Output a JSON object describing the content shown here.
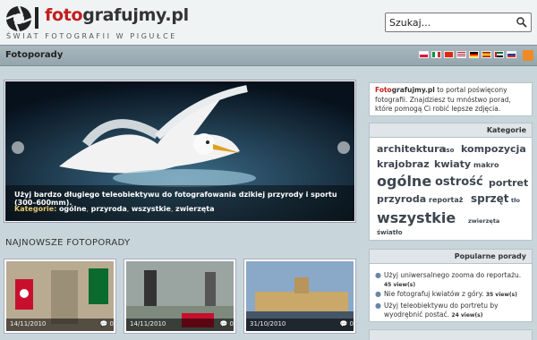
{
  "header": {
    "logo_red": "foto",
    "logo_dark": "grafujmy.pl",
    "tagline": "ŚWIAT FOTOGRAFII W PIGUŁCE",
    "search_placeholder": "Szukaj..."
  },
  "nav": {
    "title": "Fotoporady"
  },
  "flags": [
    "pl",
    "it",
    "cn",
    "us",
    "de",
    "es",
    "ae",
    "ru"
  ],
  "slider": {
    "caption": "Użyj bardzo długiego teleobiektywu do fotografowania dzikiej przyrody i sportu (300–600mm).",
    "categories_label": "Kategorie:",
    "categories": [
      "ogólne",
      "przyroda",
      "wszystkie",
      "zwierzęta"
    ]
  },
  "newest": {
    "heading": "NAJNOWSZE FOTOPORADY",
    "items": [
      {
        "date": "14/11/2010",
        "comments": "0"
      },
      {
        "date": "14/11/2010",
        "comments": "0"
      },
      {
        "date": "31/10/2010",
        "comments": "0"
      }
    ]
  },
  "about": {
    "brand_red": "Foto",
    "brand_rest": "grafujmy.pl",
    "text": " to portal poświęcony fotografii. Znajdziesz tu mnóstwo porad, które pomogą Ci robić lepsze zdjęcia."
  },
  "categories_box": {
    "title": "Kategorie",
    "tags": [
      "architektura",
      "iso",
      "kompozycja",
      "krajobraz",
      "kwiaty",
      "makro",
      "ogólne",
      "ostrość",
      "portret",
      "przyroda",
      "reportaż",
      "sprzęt",
      "tło",
      "wszystkie",
      "zwierzęta",
      "światło"
    ]
  },
  "popular": {
    "title": "Popularne porady",
    "items": [
      {
        "text": "Użyj uniwersalnego zooma do reportażu.",
        "views": "45 view(s)"
      },
      {
        "text": "Nie fotografuj kwiatów z góry.",
        "views": "35 view(s)"
      },
      {
        "text": "Użyj teleobiektywu do portretu by wyodrębnić postać.",
        "views": "24 view(s)"
      }
    ]
  },
  "colors": {
    "brand_red": "#c41e1e",
    "background": "#c8d6dc",
    "accent_link": "#e6c86a"
  }
}
